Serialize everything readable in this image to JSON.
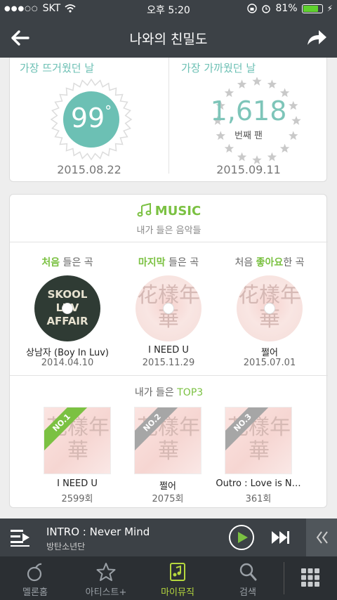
{
  "status_bar": {
    "carrier": "SKT",
    "time": "오후 5:20",
    "battery": "81%",
    "battery_level": 0.81
  },
  "nav": {
    "title": "나와의 친밀도",
    "back_icon": "arrow-left-icon",
    "share_icon": "share-arrow-icon"
  },
  "hottest": {
    "title": "가장 뜨거웠던 날",
    "value": "99",
    "unit": "°",
    "date": "2015.08.22"
  },
  "closest": {
    "title": "가장 가까웠던 날",
    "value": "1,618",
    "sub": "번째 팬",
    "date": "2015.09.11"
  },
  "music": {
    "title": "MUSIC",
    "subtitle": "내가 들은 음악들",
    "firsts": [
      {
        "hl": "처음",
        "rest": " 들은 곡",
        "pre": "",
        "song": "상남자 (Boy In Luv)",
        "date": "2014.04.10",
        "cover_text": "SKOOL LUV AFFAIR"
      },
      {
        "hl": "마지막",
        "rest": " 들은 곡",
        "pre": "",
        "song": "I NEED U",
        "date": "2015.11.29",
        "cover_text": "花樣年華"
      },
      {
        "hl": "좋아요",
        "rest": "한 곡",
        "pre": "처음 ",
        "song": "쩔어",
        "date": "2015.07.01",
        "cover_text": "花樣年華"
      }
    ],
    "top3_title_pre": "내가 들은 ",
    "top3_title_hl": "TOP3",
    "top3": [
      {
        "rank": "NO.1",
        "song": "I NEED U",
        "count": "2599회",
        "cover_text": "花樣年華"
      },
      {
        "rank": "NO.2",
        "song": "쩔어",
        "count": "2075회",
        "cover_text": "花樣年華"
      },
      {
        "rank": "NO.3",
        "song": "Outro : Love is N…",
        "count": "361회",
        "cover_text": "花樣年華"
      }
    ]
  },
  "player": {
    "title": "INTRO : Never Mind",
    "artist": "방탄소년단"
  },
  "tabs": [
    {
      "label": "멜론홈",
      "icon": "melon-home-icon"
    },
    {
      "label": "아티스트+",
      "icon": "star-icon"
    },
    {
      "label": "마이뮤직",
      "icon": "my-music-icon"
    },
    {
      "label": "검색",
      "icon": "search-icon"
    }
  ],
  "colors": {
    "accent_green": "#7bc142",
    "teal": "#6cc0b4",
    "dark": "#3c4146"
  }
}
